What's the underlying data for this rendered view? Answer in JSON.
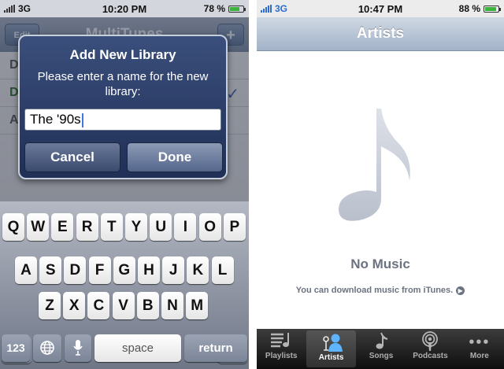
{
  "left": {
    "status": {
      "carrier": "3G",
      "time": "10:20 PM",
      "battery": "78 %",
      "battery_level": 0.78
    },
    "nav": {
      "left_button": "Edit",
      "title": "MultiTunes",
      "right_button": "+"
    },
    "list_rows": [
      {
        "text": "D",
        "checked": false
      },
      {
        "text": "Defa",
        "checked": true
      },
      {
        "text": "A",
        "checked": false
      }
    ],
    "alert": {
      "title": "Add New Library",
      "message": "Please enter a name for the new library:",
      "input_value": "The '90s",
      "cancel_label": "Cancel",
      "done_label": "Done"
    },
    "keyboard": {
      "row1": [
        "Q",
        "W",
        "E",
        "R",
        "T",
        "Y",
        "U",
        "I",
        "O",
        "P"
      ],
      "row2": [
        "A",
        "S",
        "D",
        "F",
        "G",
        "H",
        "J",
        "K",
        "L"
      ],
      "row3": [
        "Z",
        "X",
        "C",
        "V",
        "B",
        "N",
        "M"
      ],
      "numbers_label": "123",
      "space_label": "space",
      "return_label": "return"
    }
  },
  "right": {
    "status": {
      "carrier": "3G",
      "time": "10:47 PM",
      "battery": "88 %",
      "battery_level": 0.88
    },
    "nav_title": "Artists",
    "empty_title": "No Music",
    "empty_message": "You can download music from iTunes.",
    "tabs": [
      {
        "label": "Playlists",
        "icon": "playlists-icon",
        "selected": false
      },
      {
        "label": "Artists",
        "icon": "artists-icon",
        "selected": true
      },
      {
        "label": "Songs",
        "icon": "songs-icon",
        "selected": false
      },
      {
        "label": "Podcasts",
        "icon": "podcasts-icon",
        "selected": false
      },
      {
        "label": "More",
        "icon": "more-icon",
        "selected": false
      }
    ]
  }
}
